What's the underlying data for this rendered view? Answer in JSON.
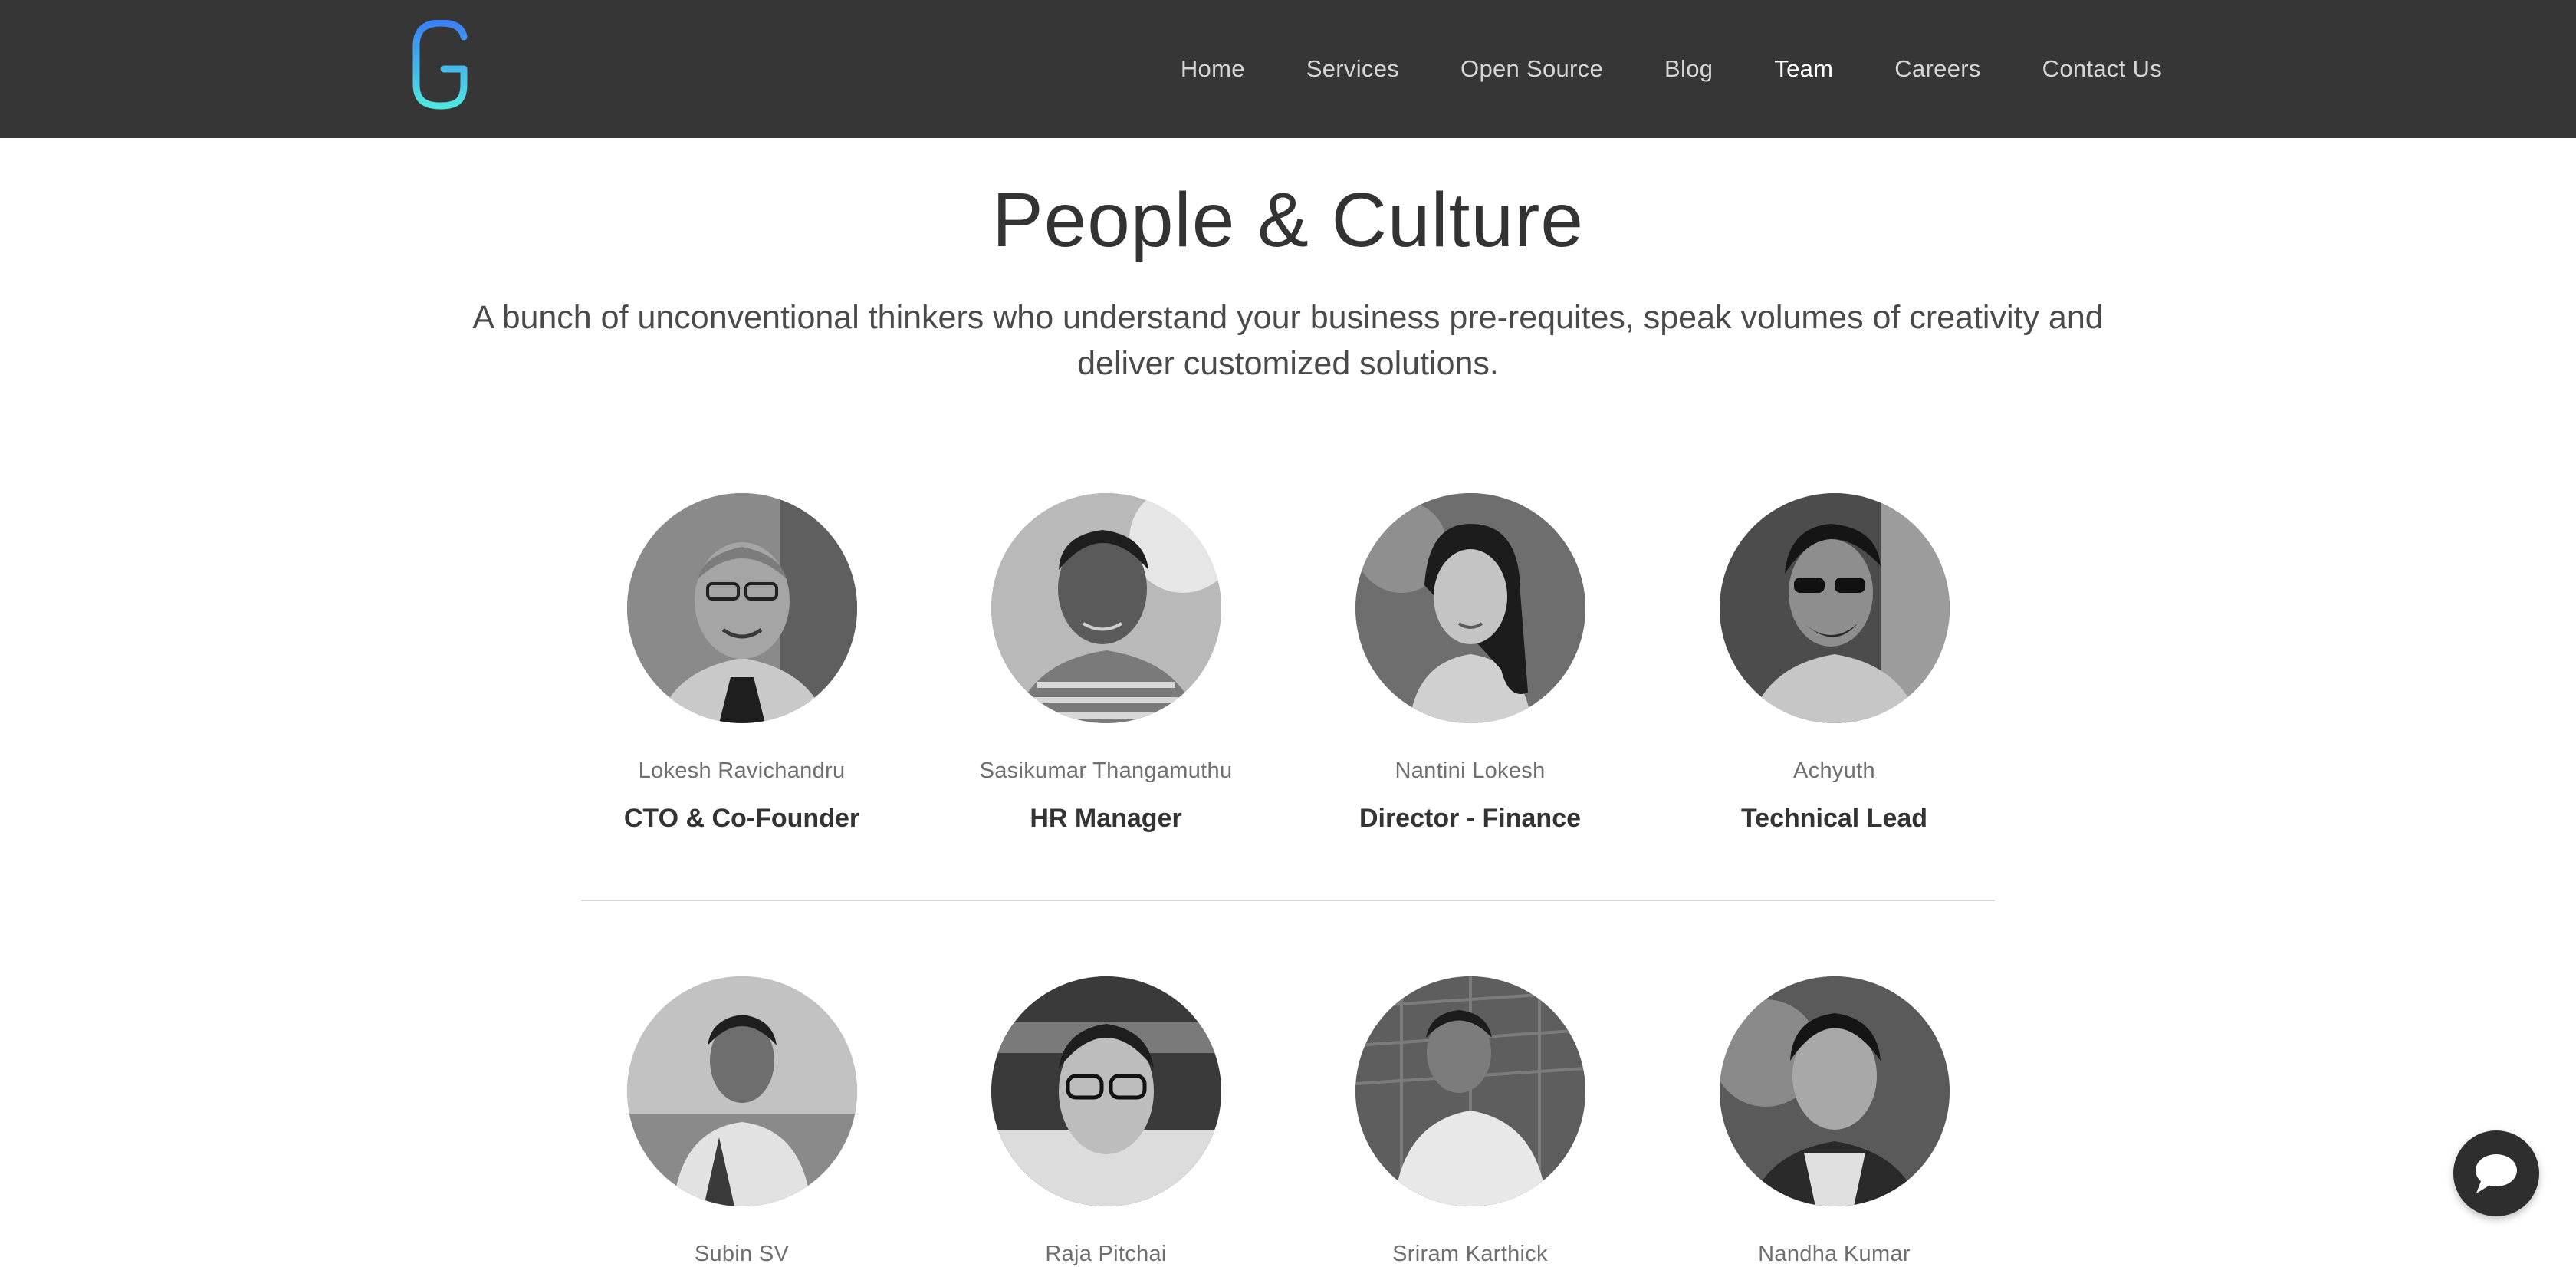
{
  "header": {
    "logo_letter": "G",
    "nav": [
      {
        "label": "Home",
        "active": false
      },
      {
        "label": "Services",
        "active": false
      },
      {
        "label": "Open Source",
        "active": false
      },
      {
        "label": "Blog",
        "active": false
      },
      {
        "label": "Team",
        "active": true
      },
      {
        "label": "Careers",
        "active": false
      },
      {
        "label": "Contact Us",
        "active": false
      }
    ]
  },
  "hero": {
    "title": "People & Culture",
    "subtitle": "A bunch of unconventional thinkers who understand your business pre-requites, speak volumes of creativity and deliver customized solutions."
  },
  "team": {
    "row1": [
      {
        "name": "Lokesh Ravichandru",
        "role": "CTO & Co-Founder"
      },
      {
        "name": "Sasikumar Thangamuthu",
        "role": "HR Manager"
      },
      {
        "name": "Nantini Lokesh",
        "role": "Director - Finance"
      },
      {
        "name": "Achyuth",
        "role": "Technical Lead"
      }
    ],
    "row2": [
      {
        "name": "Subin SV",
        "role": ""
      },
      {
        "name": "Raja Pitchai",
        "role": ""
      },
      {
        "name": "Sriram Karthick",
        "role": ""
      },
      {
        "name": "Nandha Kumar",
        "role": ""
      }
    ]
  },
  "colors": {
    "header_bg": "#363636",
    "logo_gradient_top": "#3b82f6",
    "logo_gradient_bottom": "#4ee6e0",
    "chat_button": "#2e2e2e"
  },
  "icons": {
    "logo": "g-logo-icon",
    "chat": "chat-bubble-icon"
  }
}
